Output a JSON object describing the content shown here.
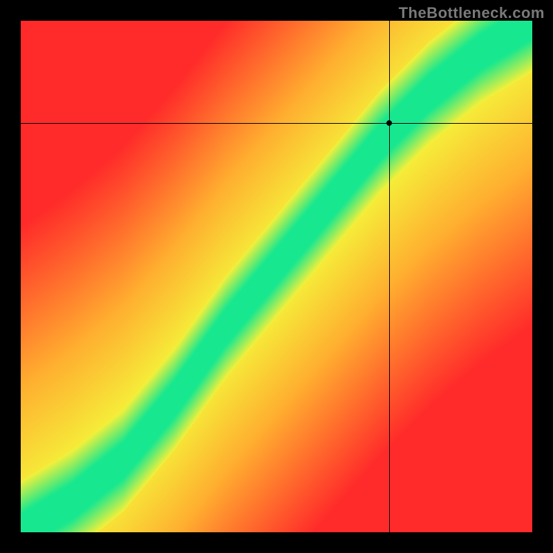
{
  "watermark": "TheBottleneck.com",
  "chart_data": {
    "type": "heatmap",
    "title": "",
    "xlabel": "",
    "ylabel": "",
    "xlim": [
      0,
      100
    ],
    "ylim": [
      0,
      100
    ],
    "crosshair": {
      "x": 72,
      "y": 80
    },
    "note": "Heatmap shows an S-shaped green optimal band running from lower-left to upper-right on a red-yellow gradient field. Crosshair marker sits near the upper portion of the band.",
    "optimal_band": [
      {
        "x": 0,
        "y": 0
      },
      {
        "x": 10,
        "y": 6
      },
      {
        "x": 20,
        "y": 14
      },
      {
        "x": 30,
        "y": 26
      },
      {
        "x": 40,
        "y": 40
      },
      {
        "x": 50,
        "y": 52
      },
      {
        "x": 60,
        "y": 64
      },
      {
        "x": 70,
        "y": 76
      },
      {
        "x": 80,
        "y": 86
      },
      {
        "x": 90,
        "y": 94
      },
      {
        "x": 100,
        "y": 100
      }
    ],
    "band_width": 10,
    "colors": {
      "optimal": "#17e890",
      "near": "#f6f13a",
      "mid": "#ffb030",
      "far": "#ff2a2a"
    }
  }
}
